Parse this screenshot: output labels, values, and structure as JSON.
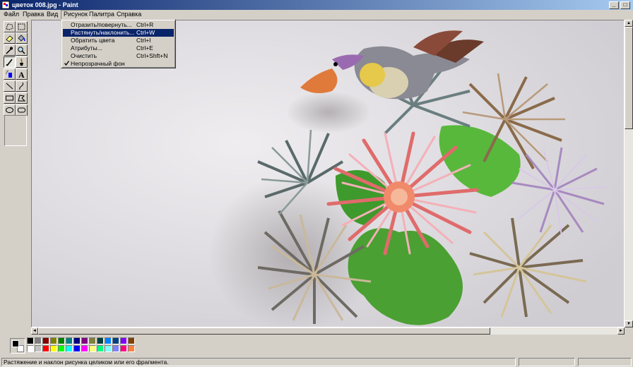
{
  "window": {
    "title": "цветок 008.jpg - Paint"
  },
  "menubar": {
    "items": [
      "Файл",
      "Правка",
      "Вид",
      "Рисунок",
      "Палитра",
      "Справка"
    ]
  },
  "dropdown": {
    "items": [
      {
        "label": "Отразить/повернуть...",
        "shortcut": "Ctrl+R"
      },
      {
        "label": "Растянуть/наклонить...",
        "shortcut": "Ctrl+W"
      },
      {
        "label": "Обратить цвета",
        "shortcut": "Ctrl+I"
      },
      {
        "label": "Атрибуты...",
        "shortcut": "Ctrl+E"
      },
      {
        "label": "Очистить",
        "shortcut": "Ctrl+Shft+N"
      },
      {
        "label": "Непрозрачный фон",
        "shortcut": ""
      }
    ]
  },
  "tools": [
    "free-select",
    "rect-select",
    "eraser",
    "fill",
    "color-picker",
    "magnifier",
    "pencil",
    "brush",
    "airbrush",
    "text",
    "line",
    "curve",
    "rectangle",
    "polygon",
    "ellipse",
    "rounded-rectangle"
  ],
  "palette": {
    "foreground": "#000000",
    "background": "#ffffff",
    "row1": [
      "#000000",
      "#808080",
      "#800000",
      "#808000",
      "#008000",
      "#008080",
      "#000080",
      "#800080",
      "#808040",
      "#004040",
      "#0080ff",
      "#004080",
      "#8000ff",
      "#804000"
    ],
    "row2": [
      "#ffffff",
      "#c0c0c0",
      "#ff0000",
      "#ffff00",
      "#00ff00",
      "#00ffff",
      "#0000ff",
      "#ff00ff",
      "#ffff80",
      "#00ff80",
      "#80ffff",
      "#8080ff",
      "#ff0080",
      "#ff8040"
    ]
  },
  "status": {
    "text": "Растяжение и наклон рисунка целиком или его фрагмента."
  }
}
